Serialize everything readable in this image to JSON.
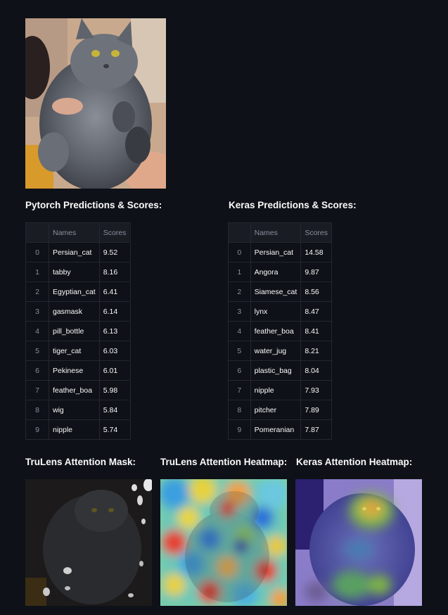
{
  "pytorch": {
    "title": "Pytorch Predictions & Scores:",
    "columns": [
      "",
      "Names",
      "Scores"
    ],
    "rows": [
      [
        "0",
        "Persian_cat",
        "9.52"
      ],
      [
        "1",
        "tabby",
        "8.16"
      ],
      [
        "2",
        "Egyptian_cat",
        "6.41"
      ],
      [
        "3",
        "gasmask",
        "6.14"
      ],
      [
        "4",
        "pill_bottle",
        "6.13"
      ],
      [
        "5",
        "tiger_cat",
        "6.03"
      ],
      [
        "6",
        "Pekinese",
        "6.01"
      ],
      [
        "7",
        "feather_boa",
        "5.98"
      ],
      [
        "8",
        "wig",
        "5.84"
      ],
      [
        "9",
        "nipple",
        "5.74"
      ]
    ]
  },
  "keras": {
    "title": "Keras Predictions & Scores:",
    "columns": [
      "",
      "Names",
      "Scores"
    ],
    "rows": [
      [
        "0",
        "Persian_cat",
        "14.58"
      ],
      [
        "1",
        "Angora",
        "9.87"
      ],
      [
        "2",
        "Siamese_cat",
        "8.56"
      ],
      [
        "3",
        "lynx",
        "8.47"
      ],
      [
        "4",
        "feather_boa",
        "8.41"
      ],
      [
        "5",
        "water_jug",
        "8.21"
      ],
      [
        "6",
        "plastic_bag",
        "8.04"
      ],
      [
        "7",
        "nipple",
        "7.93"
      ],
      [
        "8",
        "pitcher",
        "7.89"
      ],
      [
        "9",
        "Pomeranian",
        "7.87"
      ]
    ]
  },
  "attention": {
    "mask_title": "TruLens Attention Mask:",
    "trulens_heatmap_title": "TruLens Attention Heatmap:",
    "keras_heatmap_title": "Keras Attention Heatmap:"
  },
  "theme": {
    "background": "#0e1117",
    "text": "#fafafa",
    "table_border": "#262730",
    "table_header_bg": "#1a1c24",
    "muted_text": "#8b8f9a"
  }
}
